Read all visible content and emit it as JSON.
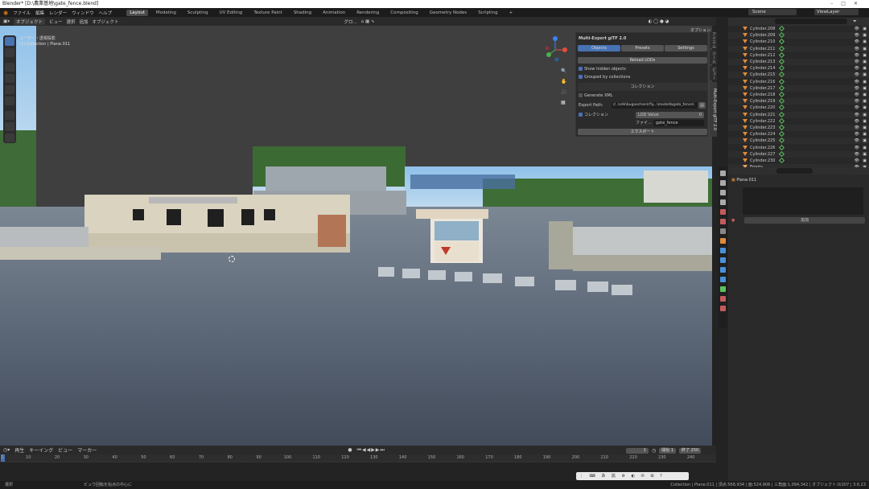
{
  "window": {
    "title": "Blender* [D:\\農業基地\\gate_fence.blend]"
  },
  "menu": [
    "ファイル",
    "編集",
    "レンダー",
    "ウィンドウ",
    "ヘルプ"
  ],
  "workspaces": [
    "Layout",
    "Modeling",
    "Sculpting",
    "UV Editing",
    "Texture Paint",
    "Shading",
    "Animation",
    "Rendering",
    "Compositing",
    "Geometry Nodes",
    "Scripting"
  ],
  "workspace_add": "+",
  "scene": "Scene",
  "view_layer": "ViewLayer",
  "viewport_header": {
    "mode": "オブジェクト",
    "menus": [
      "ビュー",
      "選択",
      "追加",
      "オブジェクト"
    ],
    "orientation": "グロ...",
    "options": "オプション"
  },
  "viewport": {
    "info_line1": "ユーザー・透視投影",
    "info_line2": "(1) Collection | Plane.011"
  },
  "addon": {
    "title": "Multi-Export glTF 2.0",
    "tabs": [
      "Objects",
      "Presets",
      "Settings"
    ],
    "reload_lods": "Reload LODs",
    "show_hidden": "Show hidden objects",
    "grouped": "Grouped by collections",
    "collection_header": "コレクション",
    "generate_xml": "Generate XML",
    "export_path_label": "Export Path:",
    "export_path_value": "//..\\sdk\\bugaochan\\rfly...\\model\\bgate_fence\\",
    "collection_label": "コレクション",
    "lod_label": "LOD Value",
    "lod_value": "0",
    "file_label": "ファイ...",
    "file_value": "gate_fence",
    "export_button": "エクスポート"
  },
  "side_tabs": [
    "アイテム",
    "ツール",
    "ビュー",
    "Multi-Export glTF 2.0"
  ],
  "outliner": {
    "items": [
      "Cylinder.208",
      "Cylinder.209",
      "Cylinder.210",
      "Cylinder.211",
      "Cylinder.212",
      "Cylinder.213",
      "Cylinder.214",
      "Cylinder.215",
      "Cylinder.216",
      "Cylinder.217",
      "Cylinder.218",
      "Cylinder.219",
      "Cylinder.220",
      "Cylinder.221",
      "Cylinder.222",
      "Cylinder.223",
      "Cylinder.224",
      "Cylinder.225",
      "Cylinder.226",
      "Cylinder.227",
      "Cylinder.230",
      "Empty"
    ]
  },
  "properties": {
    "object_name": "Plane.011",
    "add_button": "追加"
  },
  "timeline": {
    "menus": [
      "再生",
      "キーイング",
      "ビュー",
      "マーカー"
    ],
    "current_frame": "1",
    "start_label": "開始",
    "start": "1",
    "end_label": "終了",
    "end": "250",
    "ticks": [
      "1",
      "10",
      "20",
      "30",
      "40",
      "50",
      "60",
      "70",
      "80",
      "90",
      "100",
      "110",
      "120",
      "130",
      "140",
      "150",
      "160",
      "170",
      "180",
      "190",
      "200",
      "210",
      "220",
      "230",
      "240"
    ]
  },
  "statusbar": {
    "left": "選択",
    "middle": "ビュウ回転を始点の中心に",
    "right": "Collection | Plane.011 | 頂点:568,934 | 面:524,906 | 三角面:1,094,342 | オブジェクト:0/207 | 3.6.23"
  }
}
